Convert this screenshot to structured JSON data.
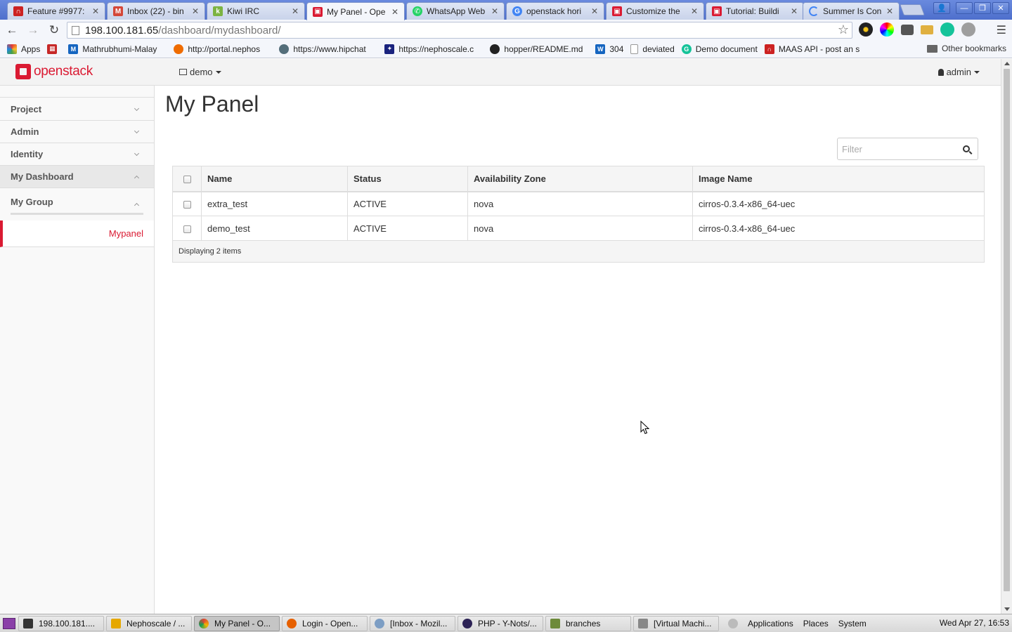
{
  "browser": {
    "tabs": [
      {
        "label": "Feature #9977:",
        "icon": "redhat-icon",
        "color": "#cc2222"
      },
      {
        "label": "Inbox (22) - bin",
        "icon": "gmail-icon",
        "color": "#d44638"
      },
      {
        "label": "Kiwi IRC",
        "icon": "kiwi-icon",
        "color": "#7cb342"
      },
      {
        "label": "My Panel - Ope",
        "icon": "openstack-icon",
        "color": "#da1a32"
      },
      {
        "label": "WhatsApp Web",
        "icon": "whatsapp-icon",
        "color": "#25d366"
      },
      {
        "label": "openstack hori",
        "icon": "google-icon",
        "color": "#4285f4"
      },
      {
        "label": "Customize the",
        "icon": "openstack-icon",
        "color": "#da1a32"
      },
      {
        "label": "Tutorial: Buildi",
        "icon": "openstack-icon",
        "color": "#da1a32"
      },
      {
        "label": "Summer Is Con",
        "icon": "loading-icon",
        "color": "#4285f4"
      }
    ],
    "url_host": "198.100.181.65",
    "url_path": "/dashboard/mydashboard/",
    "bookmarks": [
      {
        "label": "Apps",
        "icon": "apps-grid-icon",
        "color": "#e53935"
      },
      {
        "label": "",
        "icon": "bookmark-red-icon",
        "color": "#c62828"
      },
      {
        "label": "Mathrubhumi-Malay",
        "icon": "mathrubhumi-icon",
        "color": "#1565c0"
      },
      {
        "label": "http://portal.nephos",
        "icon": "globe-icon",
        "color": "#ef6c00"
      },
      {
        "label": "https://www.hipchat",
        "icon": "chat-icon",
        "color": "#546e7a"
      },
      {
        "label": "https://nephoscale.c",
        "icon": "nephoscale-icon",
        "color": "#1a237e"
      },
      {
        "label": "hopper/README.md",
        "icon": "github-icon",
        "color": "#222222"
      },
      {
        "label": "304",
        "icon": "w3-icon",
        "color": "#1565c0"
      },
      {
        "label": "deviated",
        "icon": "page-icon",
        "color": "#999999"
      },
      {
        "label": "Demo document",
        "icon": "grammarly-icon",
        "color": "#15c39a"
      },
      {
        "label": "MAAS API - post an s",
        "icon": "redhat-icon",
        "color": "#cc2222"
      }
    ],
    "other_bookmarks": "Other bookmarks"
  },
  "topbar": {
    "logo": "openstack",
    "project": "demo",
    "user": "admin"
  },
  "sidebar": {
    "items": [
      {
        "label": "Project"
      },
      {
        "label": "Admin"
      },
      {
        "label": "Identity"
      },
      {
        "label": "My Dashboard"
      }
    ],
    "group": "My Group",
    "panel": "Mypanel"
  },
  "main": {
    "title": "My Panel",
    "filter_placeholder": "Filter",
    "columns": [
      "Name",
      "Status",
      "Availability Zone",
      "Image Name"
    ],
    "rows": [
      {
        "name": "extra_test",
        "status": "ACTIVE",
        "zone": "nova",
        "image": "cirros-0.3.4-x86_64-uec"
      },
      {
        "name": "demo_test",
        "status": "ACTIVE",
        "zone": "nova",
        "image": "cirros-0.3.4-x86_64-uec"
      }
    ],
    "footer": "Displaying 2 items"
  },
  "taskbar": {
    "tasks": [
      {
        "label": "198.100.181....",
        "icon": "terminal-icon",
        "color": "#333333"
      },
      {
        "label": "Nephoscale / ...",
        "icon": "editor-icon",
        "color": "#e6a800"
      },
      {
        "label": "My Panel - O...",
        "icon": "chrome-icon",
        "color": "#4285f4"
      },
      {
        "label": "Login - Open...",
        "icon": "firefox-icon",
        "color": "#e66000"
      },
      {
        "label": "[Inbox - Mozil...",
        "icon": "thunderbird-icon",
        "color": "#7d9ec4"
      },
      {
        "label": "PHP - Y-Nots/...",
        "icon": "eclipse-icon",
        "color": "#2c2255"
      },
      {
        "label": "branches",
        "icon": "folder-icon",
        "color": "#6d8a3a"
      },
      {
        "label": "[Virtual Machi...",
        "icon": "vm-icon",
        "color": "#888888"
      }
    ],
    "menus": [
      "Applications",
      "Places",
      "System"
    ],
    "clock": "Wed Apr 27, 16:53"
  },
  "colors": {
    "accent": "#da1a32",
    "tabstrip": "#5a7bd4"
  }
}
